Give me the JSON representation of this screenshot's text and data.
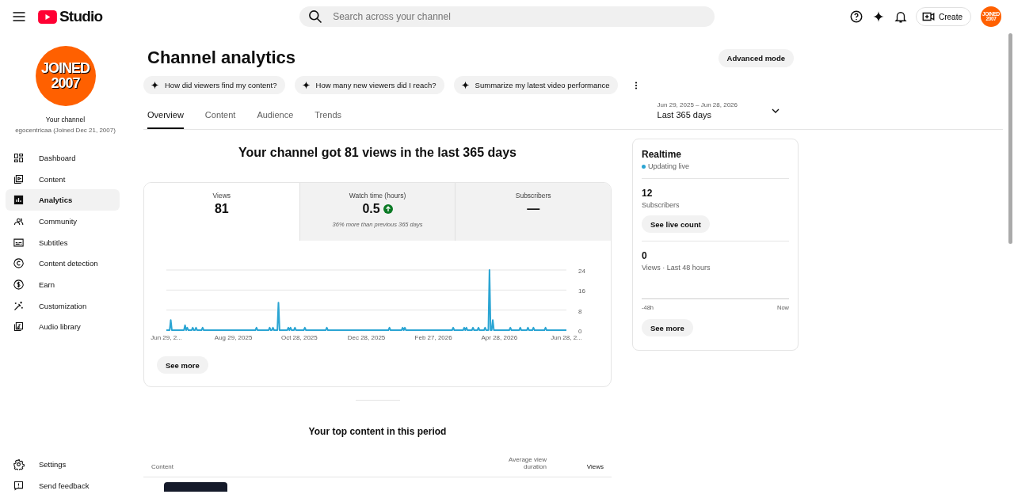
{
  "header": {
    "logo_text": "Studio",
    "search": {
      "placeholder": "Search across your channel"
    },
    "create_button": "Create",
    "avatar_text": "JOINED 2007"
  },
  "sidebar": {
    "avatar_text": [
      "JOINED",
      "2007"
    ],
    "channel_label": "Your channel",
    "channel_name": "egocentricaa (Joined Dec 21, 2007)",
    "items": [
      {
        "label": "Dashboard",
        "selected": false
      },
      {
        "label": "Content",
        "selected": false
      },
      {
        "label": "Analytics",
        "selected": true
      },
      {
        "label": "Community",
        "selected": false
      },
      {
        "label": "Subtitles",
        "selected": false
      },
      {
        "label": "Content detection",
        "selected": false
      },
      {
        "label": "Earn",
        "selected": false
      },
      {
        "label": "Customization",
        "selected": false
      },
      {
        "label": "Audio library",
        "selected": false
      }
    ],
    "footer_items": [
      {
        "label": "Settings"
      },
      {
        "label": "Send feedback"
      }
    ]
  },
  "page": {
    "title": "Channel analytics",
    "advanced_button": "Advanced mode",
    "suggestions": [
      "How did viewers find my content?",
      "How many new viewers did I reach?",
      "Summarize my latest video performance"
    ],
    "tabs": [
      {
        "label": "Overview",
        "selected": true
      },
      {
        "label": "Content",
        "selected": false
      },
      {
        "label": "Audience",
        "selected": false
      },
      {
        "label": "Trends",
        "selected": false
      }
    ],
    "date_range": {
      "dates": "Jun 29, 2025 – Jun 28, 2026",
      "label": "Last 365 days"
    },
    "headline": "Your channel got 81 views in the last 365 days",
    "metrics": [
      {
        "label": "Views",
        "value": "81",
        "selected": true,
        "increase": false
      },
      {
        "label": "Watch time (hours)",
        "value": "0.5",
        "selected": false,
        "increase": true,
        "note": "36% more than previous 365 days"
      },
      {
        "label": "Subscribers",
        "value": "—",
        "selected": false,
        "increase": false
      }
    ],
    "chart_data": {
      "type": "line",
      "xlim": [
        "2025-06-29",
        "2026-06-28"
      ],
      "ylim": [
        0,
        24
      ],
      "yticks": [
        0,
        8,
        16,
        24
      ],
      "xticks": [
        {
          "value": "2025-06-29",
          "label": "Jun 29, 2..."
        },
        {
          "value": "2025-08-29",
          "label": "Aug 29, 2025"
        },
        {
          "value": "2025-10-28",
          "label": "Oct 28, 2025"
        },
        {
          "value": "2025-12-28",
          "label": "Dec 28, 2025"
        },
        {
          "value": "2026-02-27",
          "label": "Feb 27, 2026"
        },
        {
          "value": "2026-04-28",
          "label": "Apr 28, 2026"
        },
        {
          "value": "2026-06-28",
          "label": "Jun 28, 2..."
        }
      ],
      "x": [
        "2025-06-29",
        "2025-07-02",
        "2025-07-03",
        "2025-07-04",
        "2025-07-15",
        "2025-07-16",
        "2025-07-17",
        "2025-07-18",
        "2025-07-19",
        "2025-07-22",
        "2025-07-23",
        "2025-07-24",
        "2025-07-25",
        "2025-07-26",
        "2025-07-27",
        "2025-07-31",
        "2025-08-01",
        "2025-08-02",
        "2025-09-18",
        "2025-09-19",
        "2025-09-20",
        "2025-09-30",
        "2025-10-01",
        "2025-10-02",
        "2025-10-03",
        "2025-10-04",
        "2025-10-05",
        "2025-10-08",
        "2025-10-09",
        "2025-10-10",
        "2025-10-17",
        "2025-10-18",
        "2025-10-19",
        "2025-10-20",
        "2025-10-21",
        "2025-10-23",
        "2025-10-24",
        "2025-10-25",
        "2025-11-01",
        "2025-11-02",
        "2025-11-03",
        "2025-11-21",
        "2025-11-22",
        "2025-11-23",
        "2026-01-17",
        "2026-01-18",
        "2026-01-19",
        "2026-01-29",
        "2026-01-30",
        "2026-01-31",
        "2026-02-01",
        "2026-02-02",
        "2026-03-16",
        "2026-03-17",
        "2026-03-18",
        "2026-03-26",
        "2026-03-27",
        "2026-03-28",
        "2026-03-29",
        "2026-03-30",
        "2026-04-03",
        "2026-04-04",
        "2026-04-05",
        "2026-04-08",
        "2026-04-09",
        "2026-04-10",
        "2026-04-14",
        "2026-04-15",
        "2026-04-16",
        "2026-04-18",
        "2026-04-19",
        "2026-04-20",
        "2026-04-21",
        "2026-04-22",
        "2026-04-23",
        "2026-05-07",
        "2026-05-08",
        "2026-05-09",
        "2026-05-16",
        "2026-05-17",
        "2026-05-18",
        "2026-05-23",
        "2026-05-24",
        "2026-05-25",
        "2026-05-28",
        "2026-05-29",
        "2026-05-30",
        "2026-06-08",
        "2026-06-09",
        "2026-06-10",
        "2026-06-28"
      ],
      "series": [
        {
          "color": "#2ba5d3",
          "values": [
            0,
            0,
            4,
            0,
            0,
            2,
            0,
            1,
            0,
            0,
            1,
            0,
            0,
            1,
            0,
            0,
            1,
            0,
            0,
            1,
            0,
            0,
            1,
            0,
            0,
            1,
            0,
            0,
            11,
            0,
            0,
            1,
            0,
            1,
            0,
            0,
            1,
            0,
            0,
            1,
            0,
            0,
            1,
            0,
            0,
            1,
            0,
            0,
            1,
            0,
            1,
            0,
            0,
            1,
            0,
            0,
            1,
            0,
            1,
            0,
            0,
            1,
            0,
            0,
            1,
            0,
            0,
            1,
            0,
            0,
            24,
            0,
            0,
            4,
            0,
            0,
            1,
            0,
            0,
            1,
            0,
            0,
            1,
            0,
            0,
            1,
            0,
            0,
            1,
            0,
            0
          ]
        }
      ]
    },
    "see_more": "See more",
    "realtime": {
      "title": "Realtime",
      "status": "Updating live",
      "subscribers_value": "12",
      "subscribers_label": "Subscribers",
      "live_count_button": "See live count",
      "views_value": "0",
      "views_label": "Views · Last 48 hours",
      "axis_start": "-48h",
      "axis_end": "Now",
      "see_more": "See more"
    },
    "top_content": {
      "title": "Your top content in this period",
      "columns": [
        "Content",
        "Average view duration",
        "Views"
      ]
    }
  }
}
